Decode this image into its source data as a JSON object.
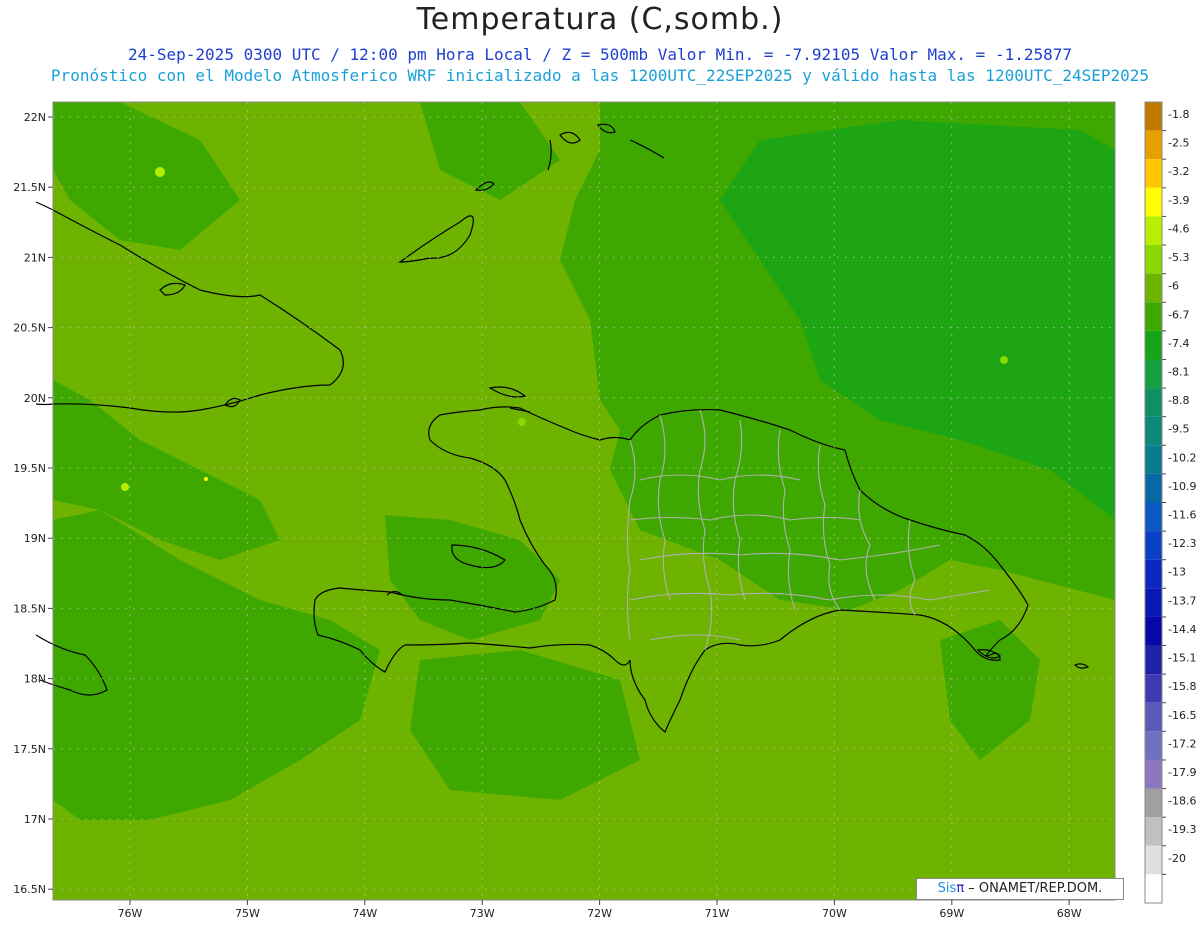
{
  "title": "Temperatura (C,somb.)",
  "subtitle1": "24-Sep-2025  0300 UTC / 12:00 pm Hora Local / Z = 500mb  Valor Min. = -7.92105  Valor Max. = -1.25877",
  "subtitle2": "Pronóstico con el Modelo Atmosferico WRF inicializado a las 1200UTC_22SEP2025 y válido hasta las  1200UTC_24SEP2025",
  "credit": {
    "sis": "Sis",
    "pi": "π",
    "rest": "– ONAMET/REP.DOM."
  },
  "lat_labels": [
    "22N",
    "21.5N",
    "21N",
    "20.5N",
    "20N",
    "19.5N",
    "19N",
    "18.5N",
    "18N",
    "17.5N",
    "17N",
    "16.5N"
  ],
  "lon_labels": [
    "76W",
    "75W",
    "74W",
    "73W",
    "72W",
    "71W",
    "70W",
    "69W",
    "68W"
  ],
  "colorbar": [
    {
      "label": "-1.8",
      "color": "#c07a00"
    },
    {
      "label": "-2.5",
      "color": "#e8a000"
    },
    {
      "label": "-3.2",
      "color": "#ffc800"
    },
    {
      "label": "-3.9",
      "color": "#ffff00"
    },
    {
      "label": "-4.6",
      "color": "#b6f000"
    },
    {
      "label": "-5.3",
      "color": "#8ad800"
    },
    {
      "label": "-6",
      "color": "#6db300"
    },
    {
      "label": "-6.7",
      "color": "#3fa800"
    },
    {
      "label": "-7.4",
      "color": "#18a418"
    },
    {
      "label": "-8.1",
      "color": "#14a040"
    },
    {
      "label": "-8.8",
      "color": "#109060"
    },
    {
      "label": "-9.5",
      "color": "#0c8878"
    },
    {
      "label": "-10.2",
      "color": "#0a7a8e"
    },
    {
      "label": "-10.9",
      "color": "#0868a6"
    },
    {
      "label": "-11.6",
      "color": "#0a58c0"
    },
    {
      "label": "-12.3",
      "color": "#0a40c8"
    },
    {
      "label": "-13",
      "color": "#0a28c0"
    },
    {
      "label": "-13.7",
      "color": "#0818b0"
    },
    {
      "label": "-14.4",
      "color": "#0808a8"
    },
    {
      "label": "-15.1",
      "color": "#2020a8"
    },
    {
      "label": "-15.8",
      "color": "#3c3cb0"
    },
    {
      "label": "-16.5",
      "color": "#5a5ab8"
    },
    {
      "label": "-17.2",
      "color": "#7070c0"
    },
    {
      "label": "-17.9",
      "color": "#8c78bc"
    },
    {
      "label": "-18.6",
      "color": "#a0a0a0"
    },
    {
      "label": "-19.3",
      "color": "#c0c0c0"
    },
    {
      "label": "-20",
      "color": "#e0e0e0"
    },
    {
      "label": "",
      "color": "#ffffff"
    }
  ],
  "colors": {
    "field_base": "#6db300",
    "field_mid": "#3fa800",
    "field_dark": "#18a418",
    "coast": "#000000",
    "provinces": "#b0b0b0"
  }
}
